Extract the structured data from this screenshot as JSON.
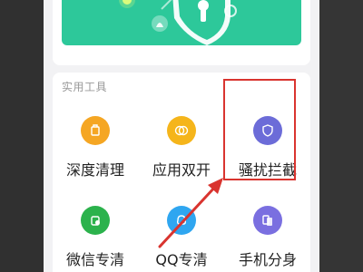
{
  "section": {
    "title": "实用工具"
  },
  "tools": [
    {
      "label": "深度清理",
      "icon": "deep-clean-icon",
      "color": "#f5a623"
    },
    {
      "label": "应用双开",
      "icon": "app-clone-icon",
      "color": "#f5b51b"
    },
    {
      "label": "骚扰拦截",
      "icon": "shield-icon",
      "color": "#6c6cd8"
    },
    {
      "label": "微信专清",
      "icon": "wechat-clean-icon",
      "color": "#2bb24c"
    },
    {
      "label": "QQ专清",
      "icon": "qq-clean-icon",
      "color": "#2fa6f0"
    },
    {
      "label": "手机分身",
      "icon": "phone-clone-icon",
      "color": "#7a6fe0"
    }
  ],
  "colors": {
    "banner": "#2dc89a",
    "highlight": "#d9342f"
  }
}
